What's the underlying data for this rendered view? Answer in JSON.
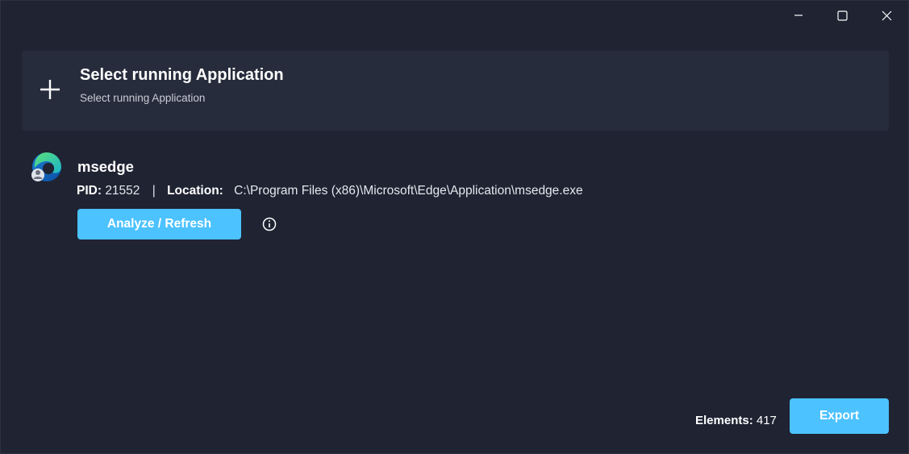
{
  "window": {
    "controls": {
      "minimize_icon": "minimize-icon",
      "maximize_icon": "maximize-icon",
      "close_icon": "close-icon"
    }
  },
  "select_card": {
    "icon": "plus-icon",
    "title": "Select running Application",
    "subtitle": "Select running Application"
  },
  "app": {
    "icon": "msedge-app-icon",
    "name": "msedge",
    "pid_label": "PID:",
    "pid": "21552",
    "separator": "|",
    "location_label": "Location:",
    "location": "C:\\Program Files (x86)\\Microsoft\\Edge\\Application\\msedge.exe",
    "analyze_button": "Analyze / Refresh",
    "info_icon": "info-icon"
  },
  "footer": {
    "elements_label": "Elements:",
    "elements_count": "417",
    "export_button": "Export"
  },
  "colors": {
    "background": "#1f2332",
    "card": "#272c3c",
    "accent": "#4cc2ff",
    "text": "#ffffff",
    "subtext": "#c8ccd6"
  }
}
